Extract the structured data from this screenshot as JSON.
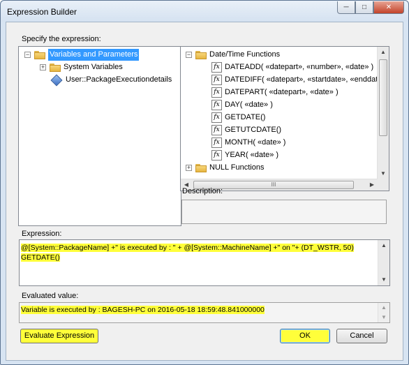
{
  "window": {
    "title": "Expression Builder"
  },
  "labels": {
    "specify": "Specify the expression:",
    "description": "Description:",
    "expression": "Expression:",
    "evaluated": "Evaluated value:"
  },
  "variables_tree": {
    "root": "Variables and Parameters",
    "items": [
      "System Variables",
      "User::PackageExecutiondetails"
    ]
  },
  "functions_tree": {
    "group": "Date/Time Functions",
    "functions": [
      "DATEADD( «datepart», «number», «date» )",
      "DATEDIFF( «datepart», «startdate», «enddate» )",
      "DATEPART( «datepart», «date» )",
      "DAY( «date» )",
      "GETDATE()",
      "GETUTCDATE()",
      "MONTH( «date» )",
      "YEAR( «date» )"
    ],
    "next_group": "NULL Functions",
    "hscroll_grip": "III"
  },
  "expression": {
    "line1": "@[System::PackageName] +\"  is executed by : \" +  @[System::MachineName] +\" on  \"+ (DT_WSTR, 50)",
    "line2": "GETDATE()"
  },
  "evaluated_value": "Variable  is executed by : BAGESH-PC on  2016-05-18 18:59:48.841000000",
  "buttons": {
    "evaluate": "Evaluate Expression",
    "ok": "OK",
    "cancel": "Cancel"
  },
  "highlight_color": "#ffff3a",
  "selection_color": "#3399ff"
}
